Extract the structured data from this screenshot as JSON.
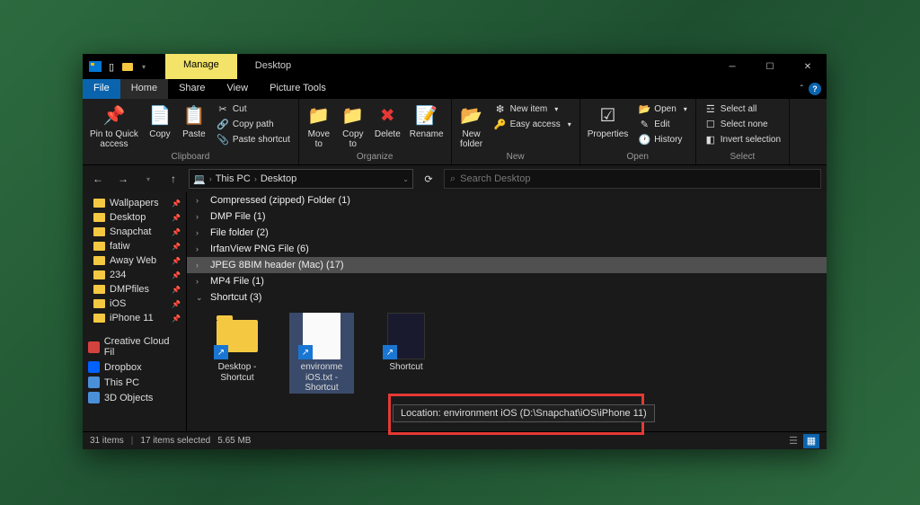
{
  "titlebar": {
    "manage_tab": "Manage",
    "title": "Desktop"
  },
  "menus": {
    "file": "File",
    "home": "Home",
    "share": "Share",
    "view": "View",
    "picture_tools": "Picture Tools"
  },
  "ribbon": {
    "clipboard": {
      "label": "Clipboard",
      "pin": "Pin to Quick\naccess",
      "copy": "Copy",
      "paste": "Paste",
      "cut": "Cut",
      "copy_path": "Copy path",
      "paste_shortcut": "Paste shortcut"
    },
    "organize": {
      "label": "Organize",
      "move_to": "Move\nto",
      "copy_to": "Copy\nto",
      "delete": "Delete",
      "rename": "Rename"
    },
    "new": {
      "label": "New",
      "new_folder": "New\nfolder",
      "new_item": "New item",
      "easy_access": "Easy access"
    },
    "open": {
      "label": "Open",
      "properties": "Properties",
      "open": "Open",
      "edit": "Edit",
      "history": "History"
    },
    "select": {
      "label": "Select",
      "select_all": "Select all",
      "select_none": "Select none",
      "invert": "Invert selection"
    }
  },
  "address": {
    "this_pc": "This PC",
    "desktop": "Desktop",
    "search_placeholder": "Search Desktop"
  },
  "sidebar": {
    "pinned": [
      "Wallpapers",
      "Desktop",
      "Snapchat",
      "fatiw",
      "Away Web",
      "234",
      "DMPfiles",
      "iOS",
      "iPhone 11"
    ],
    "services": [
      {
        "label": "Creative Cloud Fil",
        "color": "#d4423e"
      },
      {
        "label": "Dropbox",
        "color": "#0061ff"
      },
      {
        "label": "This PC",
        "color": "#4a90d9"
      },
      {
        "label": "3D Objects",
        "color": "#4a90d9"
      }
    ]
  },
  "groups": [
    {
      "chev": "›",
      "label": "Compressed (zipped) Folder (1)"
    },
    {
      "chev": "›",
      "label": "DMP File (1)"
    },
    {
      "chev": "›",
      "label": "File folder (2)"
    },
    {
      "chev": "›",
      "label": "IrfanView PNG File (6)"
    },
    {
      "chev": "›",
      "label": "JPEG 8BIM header (Mac) (17)",
      "selected": true
    },
    {
      "chev": "›",
      "label": "MP4 File (1)"
    },
    {
      "chev": "⌄",
      "label": "Shortcut (3)",
      "expanded": true
    }
  ],
  "files": [
    {
      "name": "Desktop - Shortcut",
      "type": "folder-shortcut"
    },
    {
      "name": "environme\niOS.txt - Shortcut",
      "type": "txt-shortcut",
      "selected": true
    },
    {
      "name": "Shortcut",
      "type": "generic-shortcut"
    }
  ],
  "tooltip": "Location: environment iOS (D:\\Snapchat\\iOS\\iPhone 11)",
  "status": {
    "items": "31 items",
    "selected": "17 items selected",
    "size": "5.65 MB"
  }
}
